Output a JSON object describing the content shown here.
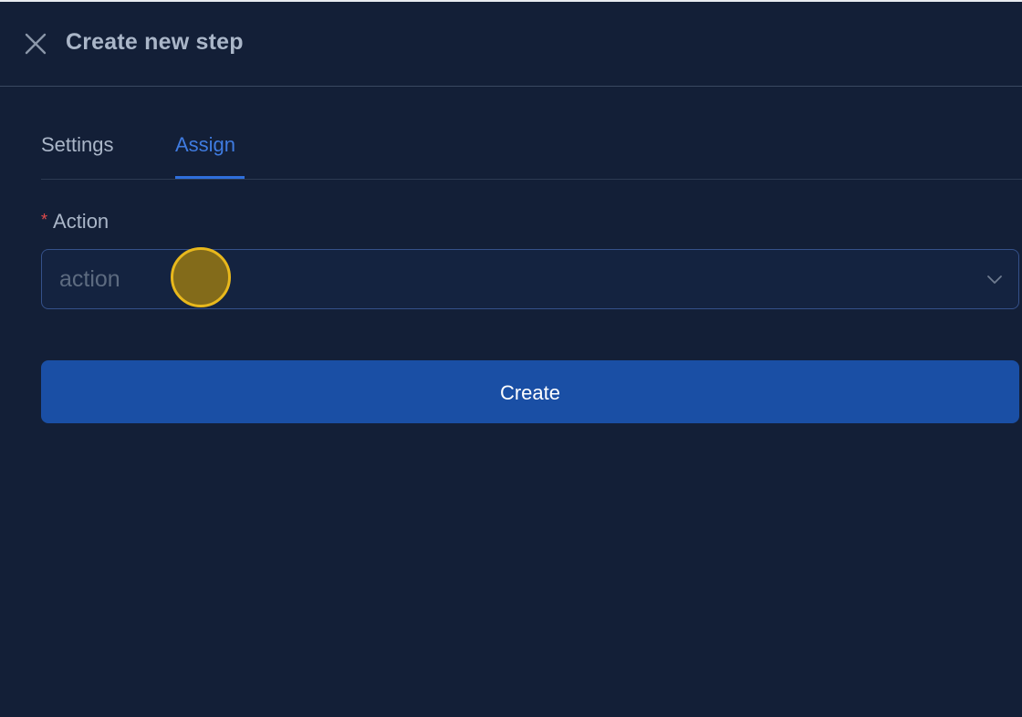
{
  "header": {
    "title": "Create new step",
    "close_icon": "close-icon"
  },
  "tabs": [
    {
      "label": "Settings",
      "active": false
    },
    {
      "label": "Assign",
      "active": true
    }
  ],
  "form": {
    "action": {
      "label": "Action",
      "required_mark": "*",
      "placeholder": "action",
      "value": "",
      "chevron_icon": "chevron-down-icon"
    },
    "submit_label": "Create"
  },
  "colors": {
    "background": "#131f37",
    "accent": "#2f6fdb",
    "button": "#1a4fa5",
    "required": "#e24b4b",
    "cursor_highlight": "#e8b81c"
  }
}
